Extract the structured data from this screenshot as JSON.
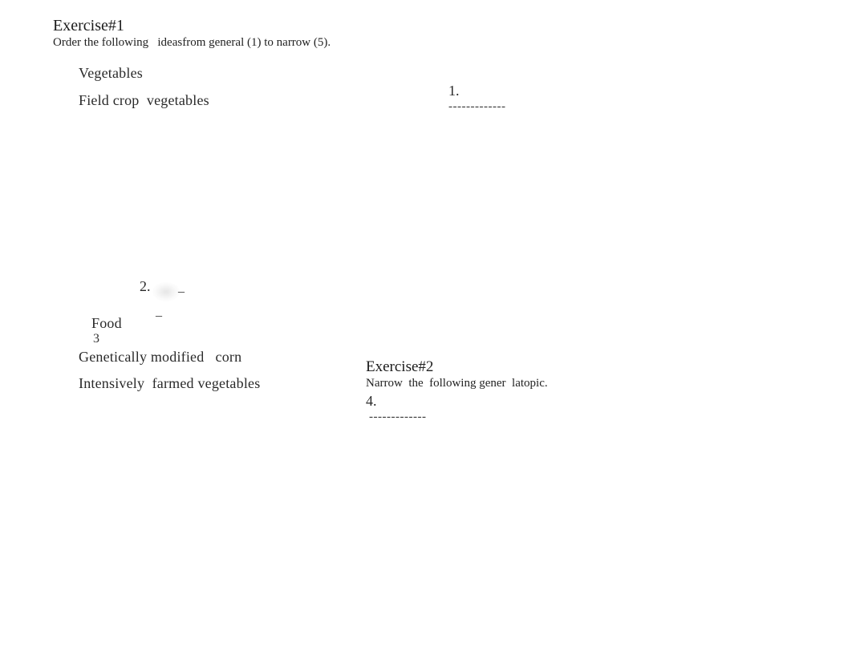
{
  "exercise1": {
    "title": "Exercise",
    "number": "#1",
    "instruction": "Order the following   ideasfrom general (1) to narrow (5).",
    "items": [
      "Vegetables",
      "Field crop  vegetables",
      "Food",
      "Genetically modified   corn",
      "Intensively  farmed vegetables"
    ],
    "food_suffix": "3",
    "answers": {
      "one_label": "1.",
      "one_blank": "-------------",
      "two_label": "2.",
      "two_blank_a": "_",
      "two_blank_b": "_"
    }
  },
  "exercise2": {
    "title": "Exercise",
    "number": "#2",
    "instruction": "Narrow  the  following gener  latopic.",
    "answers": {
      "four_label": "4.",
      "four_blank": "-------------"
    }
  }
}
